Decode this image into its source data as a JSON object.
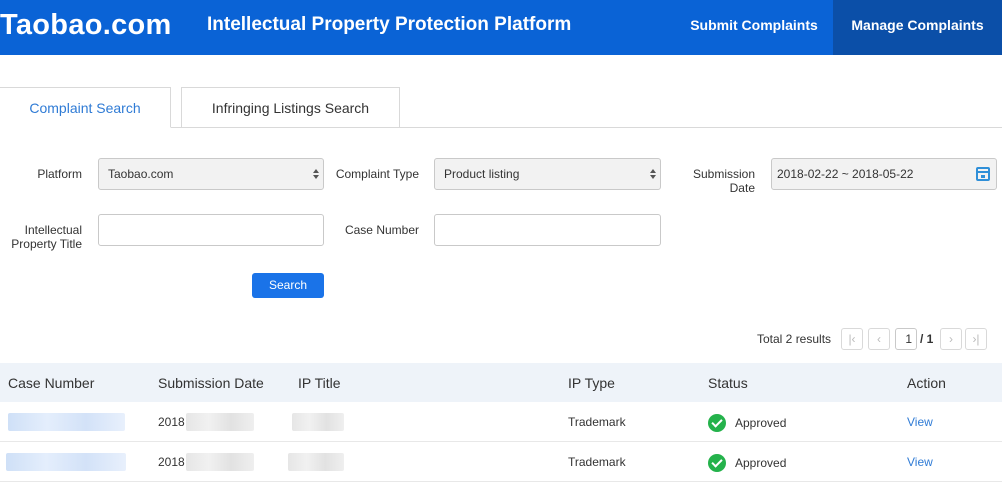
{
  "header": {
    "logo": "Taobao.com",
    "title": "Intellectual Property Protection Platform",
    "nav": {
      "submit": "Submit Complaints",
      "manage": "Manage Complaints"
    }
  },
  "tabs": {
    "complaint_search": "Complaint Search",
    "infringing_search": "Infringing Listings Search"
  },
  "form": {
    "platform_label": "Platform",
    "platform_value": "Taobao.com",
    "complaint_type_label": "Complaint Type",
    "complaint_type_value": "Product listing",
    "submission_date_label_1": "Submission",
    "submission_date_label_2": "Date",
    "submission_date_value": "2018-02-22 ~ 2018-05-22",
    "ip_title_label_1": "Intellectual",
    "ip_title_label_2": "Property Title",
    "ip_title_value": "",
    "case_number_label": "Case Number",
    "case_number_value": "",
    "search_button": "Search"
  },
  "pagination": {
    "total": "Total 2 results",
    "first": "|‹",
    "prev": "‹",
    "current": "1",
    "of_total": "/ 1",
    "next": "›",
    "last": "›|"
  },
  "table": {
    "columns": {
      "case_number": "Case Number",
      "submission_date": "Submission Date",
      "ip_title": "IP Title",
      "ip_type": "IP Type",
      "status": "Status",
      "action": "Action"
    },
    "rows": [
      {
        "date_prefix": "2018",
        "ip_type": "Trademark",
        "status": "Approved",
        "action": "View"
      },
      {
        "date_prefix": "2018",
        "ip_type": "Trademark",
        "status": "Approved",
        "action": "View"
      }
    ]
  },
  "colors": {
    "header_bg": "#0a63d6",
    "nav_active_bg": "#0b4fa8",
    "accent_blue": "#2f7bd5",
    "button_blue": "#1a73e8",
    "approved_green": "#24b24b",
    "table_header_bg": "#eef3f9"
  },
  "icons": {
    "calendar": "calendar-icon",
    "select_arrows": "select-arrows-icon",
    "approved": "check-circle-icon"
  }
}
